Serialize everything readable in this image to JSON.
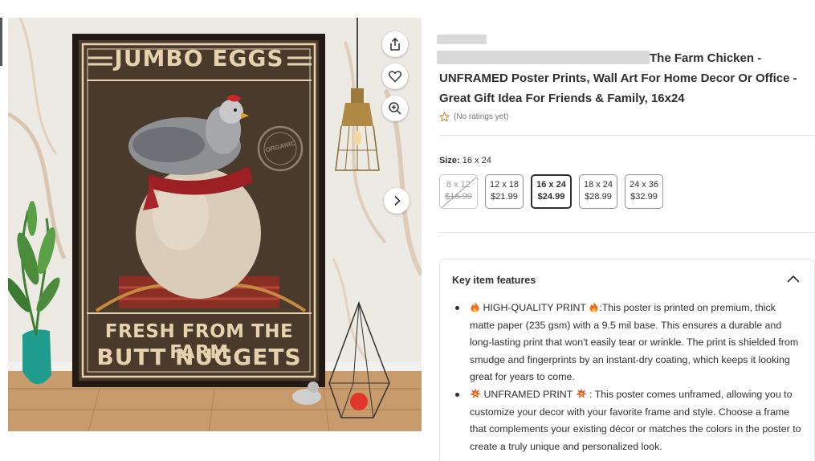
{
  "gallery": {
    "poster_text": {
      "headline": "JUMBO EGGS",
      "line1": "FRESH FROM THE FARM",
      "line2": "BUTT NUGGETS",
      "stamp": "ORGANIC"
    },
    "share_icon": "share-icon",
    "favorite_icon": "heart-icon",
    "zoom_icon": "zoom-in-icon",
    "next_icon": "chevron-right-icon"
  },
  "product": {
    "title_visible": "The Farm Chicken - UNFRAMED Poster Prints, Wall Art For Home Decor Or Office - Great Gift Idea For Friends & Family, 16x24",
    "rating_text": "(No ratings yet)",
    "rating_icon": "star-outline-icon"
  },
  "size": {
    "label": "Size:",
    "selected": "16 x 24",
    "options": [
      {
        "size": "8 x 12",
        "price": "$16.99",
        "state": "unavailable"
      },
      {
        "size": "12 x 18",
        "price": "$21.99",
        "state": "available"
      },
      {
        "size": "16 x 24",
        "price": "$24.99",
        "state": "selected"
      },
      {
        "size": "18 x 24",
        "price": "$28.99",
        "state": "available"
      },
      {
        "size": "24 x 36",
        "price": "$32.99",
        "state": "available"
      }
    ]
  },
  "features": {
    "heading": "Key item features",
    "toggle_icon": "chevron-up-icon",
    "items": [
      {
        "title": "HIGH-QUALITY PRINT",
        "icon": "fire-emoji",
        "text": ":This poster is printed on premium, thick matte paper (235 gsm) with a 9.5 mil base. This ensures a durable and long-lasting print that won't easily tear or wrinkle. The print is shielded from smudge and fingerprints by an instant-dry coating, which keeps it looking great for years to come."
      },
      {
        "title": "UNFRAMED PRINT",
        "icon": "collision-emoji",
        "text": ": This poster comes unframed, allowing you to customize your decor with your favorite frame and style. Choose a frame that complements your existing décor or matches the colors in the poster to create a truly unique and personalized look."
      }
    ]
  },
  "colors": {
    "accent_dark": "#2e2f32",
    "star": "#c2851f",
    "poster_bg": "#4a3a2c",
    "poster_text": "#e6d2ae",
    "fire": "#f26d21",
    "collision": "#e4472d"
  }
}
